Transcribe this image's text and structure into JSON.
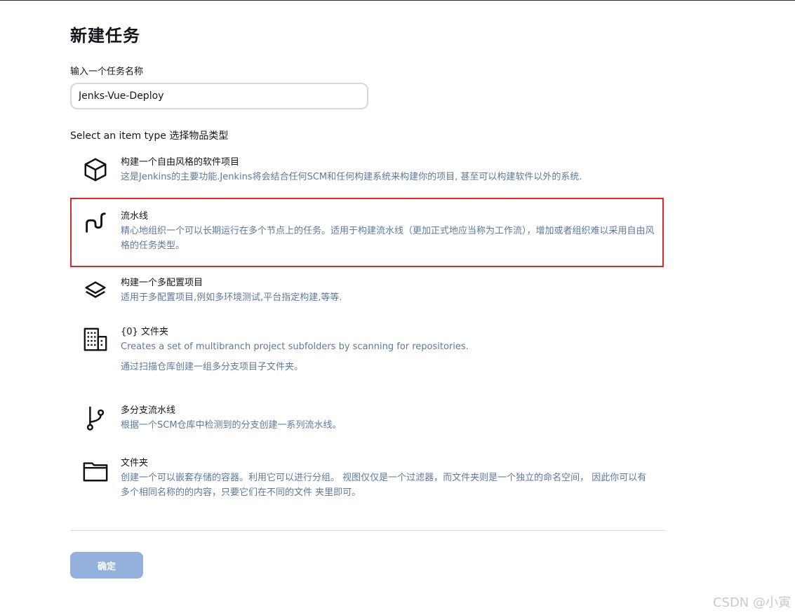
{
  "page": {
    "title": "新建任务",
    "name_label": "输入一个任务名称",
    "name_value": "Jenks-Vue-Deploy",
    "type_label": "Select an item type  选择物品类型"
  },
  "items": [
    {
      "title": "构建一个自由风格的软件项目",
      "desc": "这是Jenkins的主要功能.Jenkins将会结合任何SCM和任何构建系统来构建你的项目, 甚至可以构建软件以外的系统.",
      "icon": "cube-icon"
    },
    {
      "title": "流水线",
      "desc": "精心地组织一个可以长期运行在多个节点上的任务。适用于构建流水线（更加正式地应当称为工作流），增加或者组织难以采用自由风格的任务类型。",
      "icon": "pipeline-icon",
      "selected": true
    },
    {
      "title": "构建一个多配置项目",
      "desc": "适用于多配置项目,例如多环境测试,平台指定构建,等等.",
      "icon": "layers-icon"
    },
    {
      "title": "{0} 文件夹",
      "desc": "Creates a set of multibranch project subfolders by scanning for repositories.",
      "desc2": "通过扫描仓库创建一组多分支项目子文件夹。",
      "icon": "building-icon"
    },
    {
      "title": "多分支流水线",
      "desc": "根据一个SCM仓库中检测到的分支创建一系列流水线。",
      "icon": "branch-icon"
    },
    {
      "title": "文件夹",
      "desc": "创建一个可以嵌套存储的容器。利用它可以进行分组。 视图仅仅是一个过滤器，而文件夹则是一个独立的命名空间， 因此你可以有多个相同名称的的内容，只要它们在不同的文件 夹里即可。",
      "icon": "folder-icon"
    }
  ],
  "footer": {
    "ok_label": "确定"
  },
  "watermark": "CSDN @小寅",
  "colors": {
    "selected_border": "#e0262a",
    "desc_text": "#5b7a9c",
    "ok_button_bg": "#93b1dc"
  }
}
